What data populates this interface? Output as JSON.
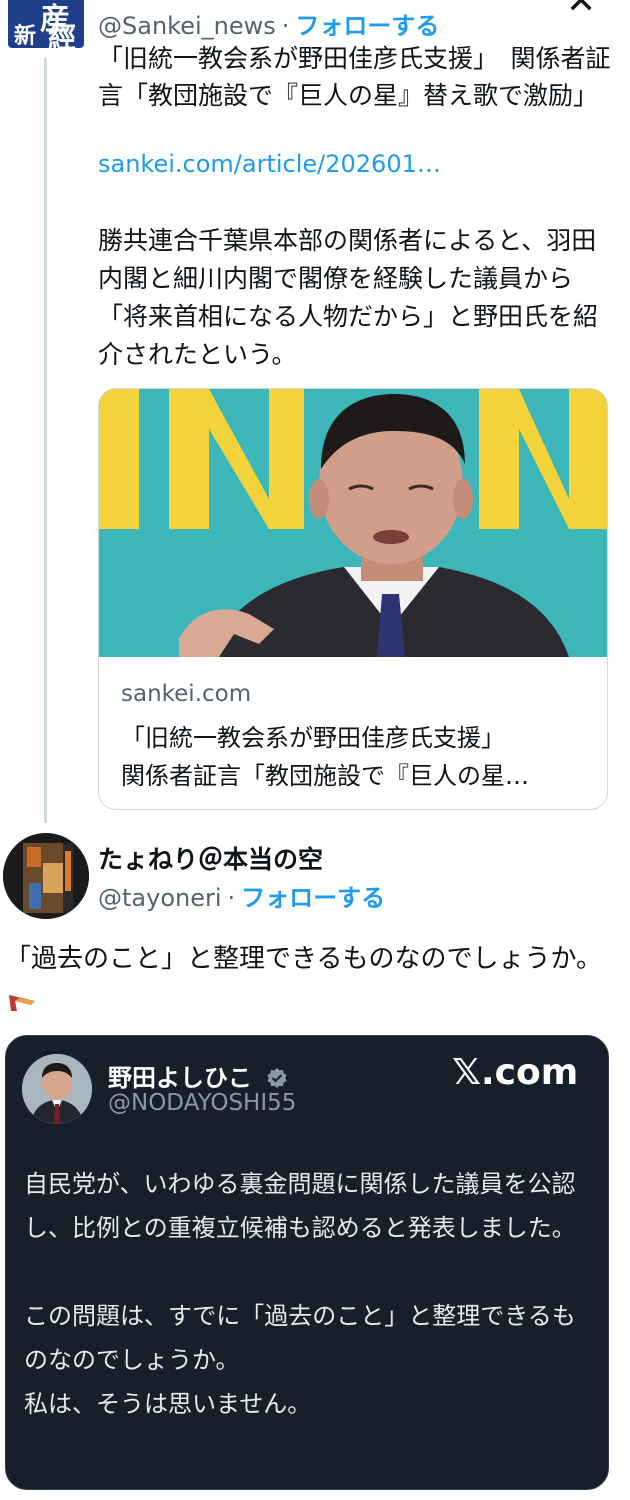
{
  "quoted_tweet": {
    "handle": "@Sankei_news",
    "separator": "·",
    "follow_label": "フォローする",
    "headline": "「旧統一教会系が野田佳彦氏支援」　関係者証言「教団施設で『巨人の星』替え歌で激励」",
    "link": "sankei.com/article/202601…",
    "body": "勝共連合千葉県本部の関係者によると、羽田内閣と細川内閣で閣僚を経験した議員から「将来首相になる人物だから」と野田氏を紹介されたという。",
    "card": {
      "domain": "sankei.com",
      "title_line1": "「旧統一教会系が野田佳彦氏支援」",
      "title_line2": "関係者証言「教団施設で『巨人の星…"
    },
    "avatar_text": [
      "産",
      "新",
      "經"
    ]
  },
  "reply_tweet": {
    "display_name": "たょねり＠本当の空",
    "handle": "@tayoneri",
    "separator": "·",
    "follow_label": "フォローする",
    "body": "「過去のこと」と整理できるものなのでしょうか。"
  },
  "embedded_post": {
    "display_name": "野田よしひこ",
    "handle": "@NODAYOSHI55",
    "brand": "𝕏.com",
    "paragraph1": "自民党が、いわゆる裏金問題に関係した議員を公認し、比例との重複立候補も認めると発表しました。",
    "paragraph2_line1": "この問題は、すでに「過去のこと」と整理できるものなのでしょうか。",
    "paragraph2_line2": "私は、そうは思いません。"
  },
  "icons": {
    "close": "x-close-icon",
    "verified": "verified-badge-icon",
    "boomerang": "boomerang-emoji-icon"
  },
  "colors": {
    "link_blue": "#1d9bf0",
    "muted_gray": "#536471",
    "dark_bg": "#15202b",
    "card_bg_teal": "#3cb6b9",
    "card_yellow": "#f2d33b"
  }
}
